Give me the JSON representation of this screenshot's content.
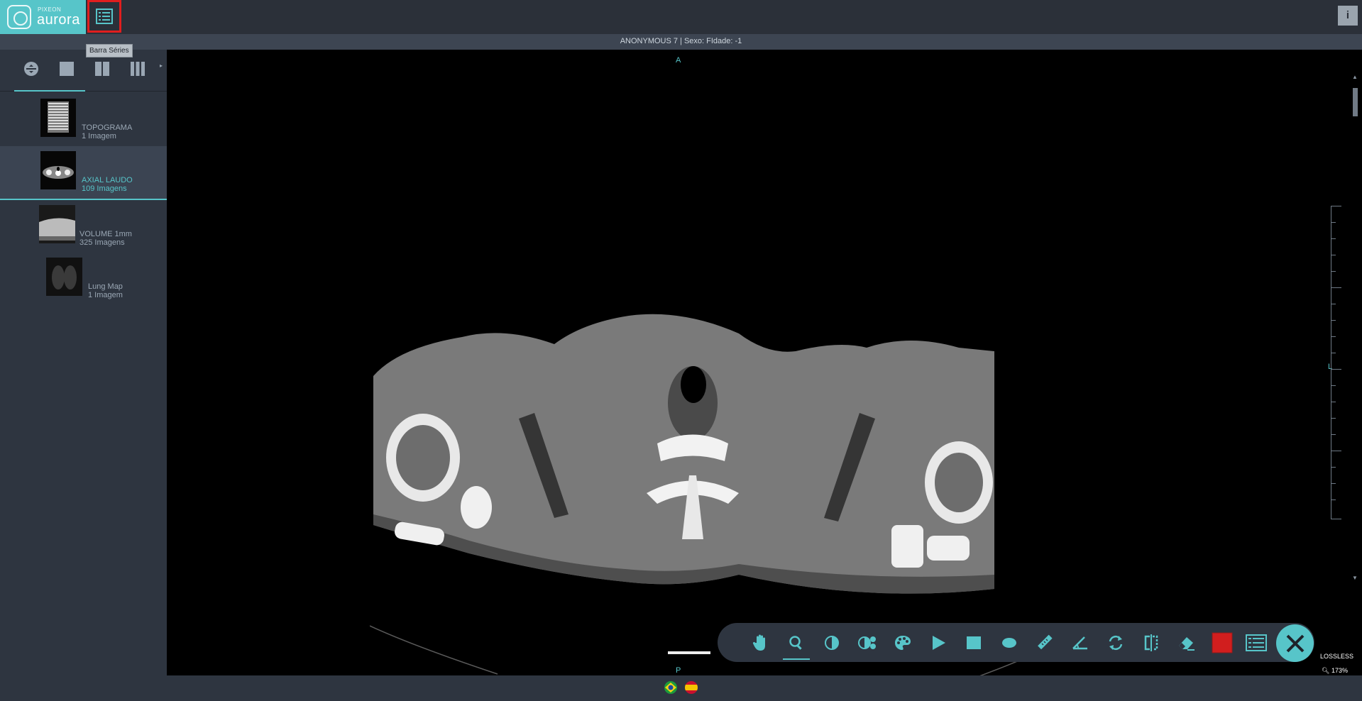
{
  "app": {
    "brand_small": "PIXEON",
    "brand": "aurora"
  },
  "header": {
    "patient_info": "ANONYMOUS 7 |    Sexo: FIdade: -1",
    "info_button": "i",
    "series_toggle_tooltip": "Barra Séries"
  },
  "sidebar": {
    "layouts": [
      "layout-fit",
      "layout-1x1",
      "layout-1x2",
      "layout-1x3"
    ],
    "series": [
      {
        "name": "TOPOGRAMA",
        "count": "1 Imagem",
        "active": false
      },
      {
        "name": "AXIAL LAUDO",
        "count": "109 Imagens",
        "active": true
      },
      {
        "name": "VOLUME 1mm",
        "count": "325 Imagens",
        "active": false
      },
      {
        "name": "Lung Map",
        "count": "1 Imagem",
        "active": false
      }
    ]
  },
  "viewer": {
    "orientation_top": "A",
    "orientation_right": "L",
    "orientation_bottom": "P",
    "compression": "LOSSLESS",
    "zoom_level": "173%"
  },
  "toolbar": {
    "tools": [
      "pan",
      "zoom",
      "window-level",
      "invert",
      "color-palette",
      "cine-play",
      "rectangle-roi",
      "ellipse-roi",
      "ruler",
      "angle",
      "rotate",
      "flip",
      "eraser",
      "color-picker",
      "series-list"
    ],
    "selected": "zoom",
    "accent": "#57c5c9",
    "color_swatch": "#d11e1e"
  },
  "languages": [
    "pt-BR",
    "es"
  ]
}
